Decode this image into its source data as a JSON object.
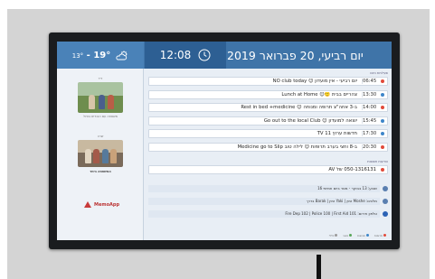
{
  "header": {
    "temperature_high": "19°",
    "temperature_low": "13°",
    "weather_icon": "partly-cloudy-icon",
    "time": "12:08",
    "date": "יום רביעי, 20 פברואר 2019"
  },
  "left_panel": {
    "photo1_caption_top": "ירד",
    "photo1_caption": "משפחה עם הנכדים בטיול",
    "photo2_caption_top": "שרה",
    "photo2_caption": "המשפחה ביחד",
    "logo_text": "MemoApp"
  },
  "schedule": {
    "section_label": "פעילויות היום",
    "items": [
      {
        "time": "06:45",
        "title": "יום רביעי - אין מועדון 😊 NO club today",
        "dot_color": "#e14b3b"
      },
      {
        "time": "13:30",
        "title": "צהריים בבית 🙂😊 Lunch at Home",
        "dot_color": "#3e86c9"
      },
      {
        "time": "14:00",
        "title": "ב-3 אחה\"צ תרופה ומנוחה 😊 Rest in bed +medicine",
        "dot_color": "#e14b3b"
      },
      {
        "time": "15:45",
        "title": "יוצאה למועדון 😊 Go out to the local Club",
        "dot_color": "#3e86c9"
      },
      {
        "time": "17:30",
        "title": "חדשות ערוץ 11 TV",
        "dot_color": "#3e86c9"
      },
      {
        "time": "20:30",
        "title": "ב-8 וחצי בערב תרופות 😊 לילה טוב Medicine go to Slip",
        "dot_color": "#e14b3b"
      }
    ]
  },
  "reminders": {
    "section_label": "הודעות חשובות",
    "phone_row": "050-1316131 של AV"
  },
  "info_rows": [
    {
      "icon": "calendar-icon",
      "icon_color": "#5a7fb0",
      "text": "שבוע: 13 בבוקר - מסר ביום חמישי 16"
    },
    {
      "icon": "people-icon",
      "icon_color": "#5a7fb0",
      "text": "מלווים: Moshe זמין | Yaki זמין | Barak בדרך"
    },
    {
      "icon": "info-icon",
      "icon_color": "#2b62b5",
      "text": "טלפון חירום: Fire Dep 102 | Police 100 | First Aid 101"
    }
  ],
  "legend": [
    {
      "label": "תרופות",
      "color": "#e14b3b"
    },
    {
      "label": "פגישות",
      "color": "#3e86c9"
    },
    {
      "label": "פנאי",
      "color": "#5aa65a"
    },
    {
      "label": "כללי",
      "color": "#9a9a9a"
    }
  ]
}
